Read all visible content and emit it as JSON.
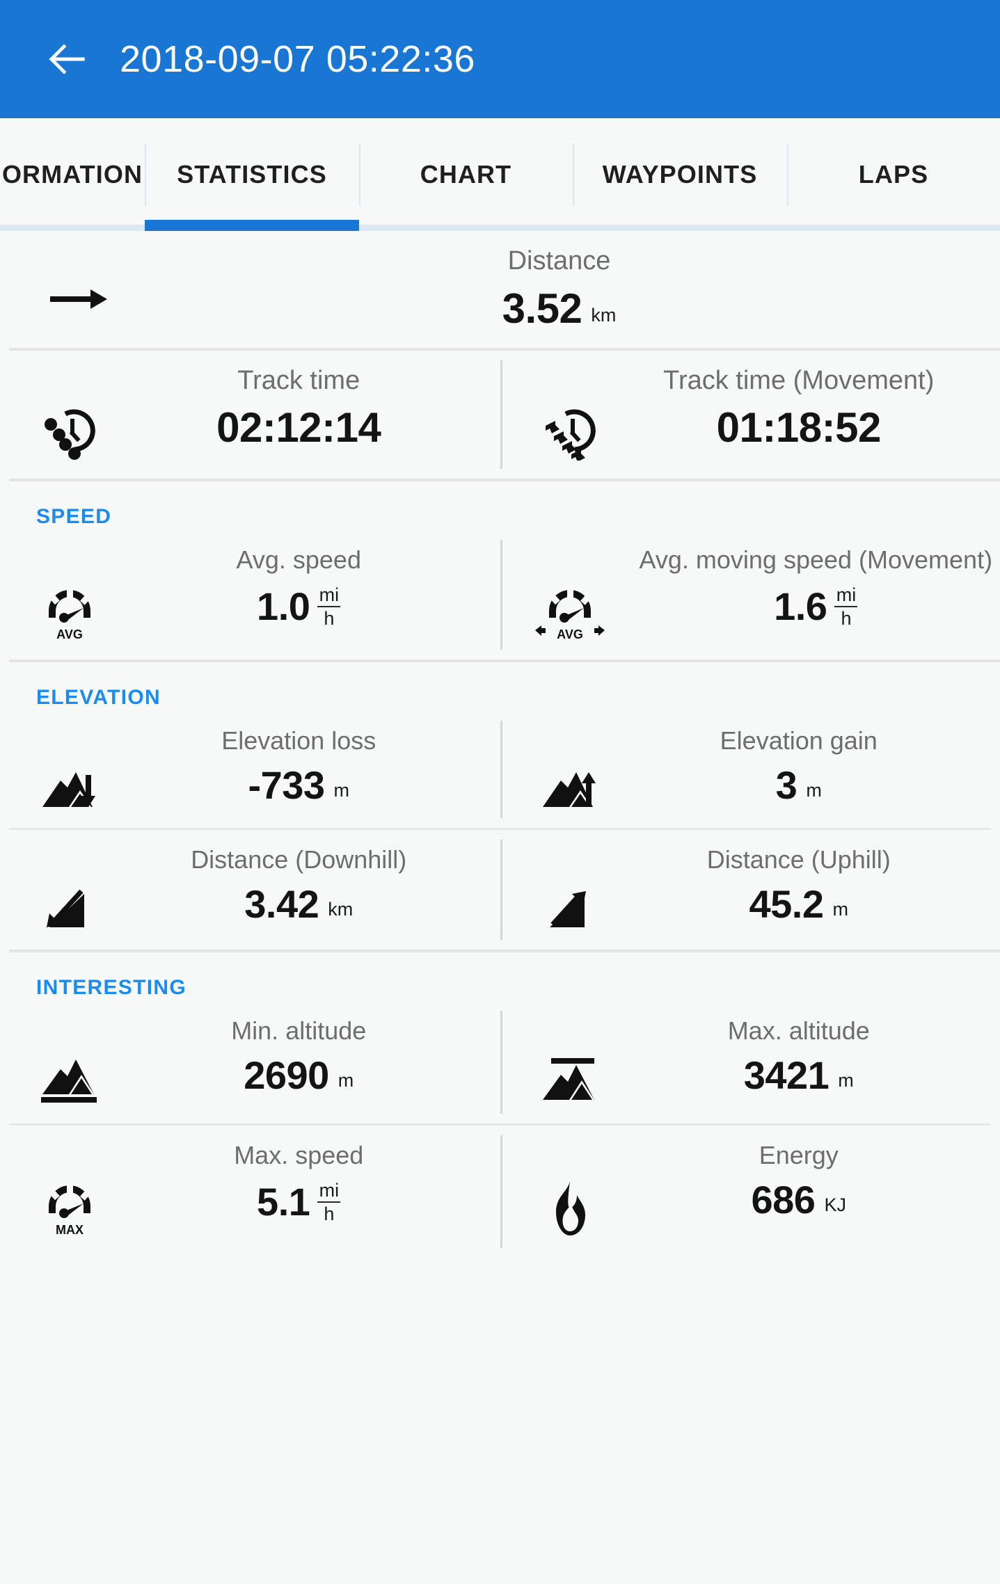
{
  "appbar": {
    "back_icon": "arrow-left-icon",
    "title": "2018-09-07 05:22:36"
  },
  "tabs": [
    {
      "label": "ORMATION",
      "selected": false
    },
    {
      "label": "STATISTICS",
      "selected": true
    },
    {
      "label": "CHART",
      "selected": false
    },
    {
      "label": "WAYPOINTS",
      "selected": false
    },
    {
      "label": "LAPS",
      "selected": false
    }
  ],
  "colors": {
    "appbar_blue": "#1976d2",
    "accent_blue": "#1a8cf0",
    "background": "#f7f8f8",
    "value_text": "#141414",
    "label_text": "#6d6d6d"
  },
  "sections": [
    {
      "title": null,
      "rows": [
        {
          "cells": [
            {
              "icon": "arrow-right-icon",
              "label": "Distance",
              "value": "3.52",
              "unit": "km",
              "unit_type": "plain"
            }
          ]
        }
      ]
    },
    {
      "title": null,
      "rows": [
        {
          "cells": [
            {
              "icon": "clock-dots-icon",
              "label": "Track time",
              "value": "02:12:14",
              "unit": "",
              "unit_type": "none"
            },
            {
              "icon": "clock-arrows-icon",
              "label": "Track time (Movement)",
              "value": "01:18:52",
              "unit": "",
              "unit_type": "none"
            }
          ]
        }
      ]
    },
    {
      "title": "SPEED",
      "rows": [
        {
          "cells": [
            {
              "icon": "speedometer-avg-icon",
              "label": "Avg. speed",
              "value": "1.0",
              "unit_num": "mi",
              "unit_den": "h",
              "unit_type": "fraction"
            },
            {
              "icon": "speedometer-avg-moving-icon",
              "label": "Avg. moving speed (Movement)",
              "value": "1.6",
              "unit_num": "mi",
              "unit_den": "h",
              "unit_type": "fraction"
            }
          ]
        }
      ]
    },
    {
      "title": "ELEVATION",
      "rows": [
        {
          "cells": [
            {
              "icon": "mountain-down-arrow-icon",
              "label": "Elevation loss",
              "value": "-733",
              "unit": "m",
              "unit_type": "plain"
            },
            {
              "icon": "mountain-up-arrow-icon",
              "label": "Elevation gain",
              "value": "3",
              "unit": "m",
              "unit_type": "plain"
            }
          ]
        },
        {
          "cells": [
            {
              "icon": "slope-downhill-icon",
              "label": "Distance (Downhill)",
              "value": "3.42",
              "unit": "km",
              "unit_type": "plain"
            },
            {
              "icon": "slope-uphill-icon",
              "label": "Distance (Uphill)",
              "value": "45.2",
              "unit": "m",
              "unit_type": "plain"
            }
          ]
        }
      ]
    },
    {
      "title": "INTERESTING",
      "rows": [
        {
          "cells": [
            {
              "icon": "mountain-min-icon",
              "label": "Min. altitude",
              "value": "2690",
              "unit": "m",
              "unit_type": "plain"
            },
            {
              "icon": "mountain-max-icon",
              "label": "Max. altitude",
              "value": "3421",
              "unit": "m",
              "unit_type": "plain"
            }
          ]
        },
        {
          "cells": [
            {
              "icon": "speedometer-max-icon",
              "label": "Max. speed",
              "value": "5.1",
              "unit_num": "mi",
              "unit_den": "h",
              "unit_type": "fraction"
            },
            {
              "icon": "flame-icon",
              "label": "Energy",
              "value": "686",
              "unit": "KJ",
              "unit_type": "plain"
            }
          ]
        }
      ]
    }
  ]
}
